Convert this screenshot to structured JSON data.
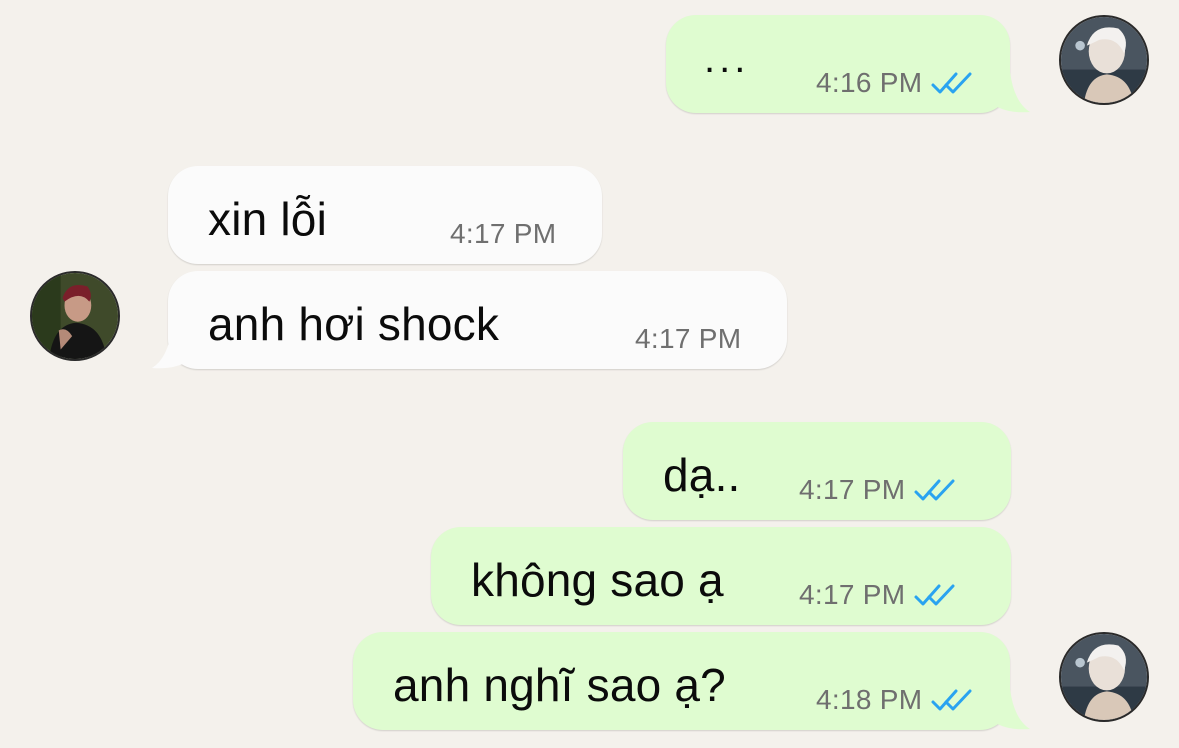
{
  "chat": {
    "messages": [
      {
        "direction": "outgoing",
        "text": "...",
        "time": "4:16 PM",
        "status": "read"
      },
      {
        "direction": "incoming",
        "text": "xin lỗi",
        "time": "4:17 PM"
      },
      {
        "direction": "incoming",
        "text": "anh hơi shock",
        "time": "4:17 PM"
      },
      {
        "direction": "outgoing",
        "text": "dạ..",
        "time": "4:17 PM",
        "status": "read"
      },
      {
        "direction": "outgoing",
        "text": "không sao ạ",
        "time": "4:17 PM",
        "status": "read"
      },
      {
        "direction": "outgoing",
        "text": "anh nghĩ sao ạ?",
        "time": "4:18 PM",
        "status": "read"
      }
    ],
    "colors": {
      "background": "#f4f1ec",
      "outgoing_bubble": "#dffcd0",
      "incoming_bubble": "#fbfbfb",
      "read_check": "#2aa3f0"
    },
    "icons": {
      "read_receipt": "double-check-icon",
      "own_avatar": "user-avatar",
      "contact_avatar": "contact-avatar"
    }
  }
}
